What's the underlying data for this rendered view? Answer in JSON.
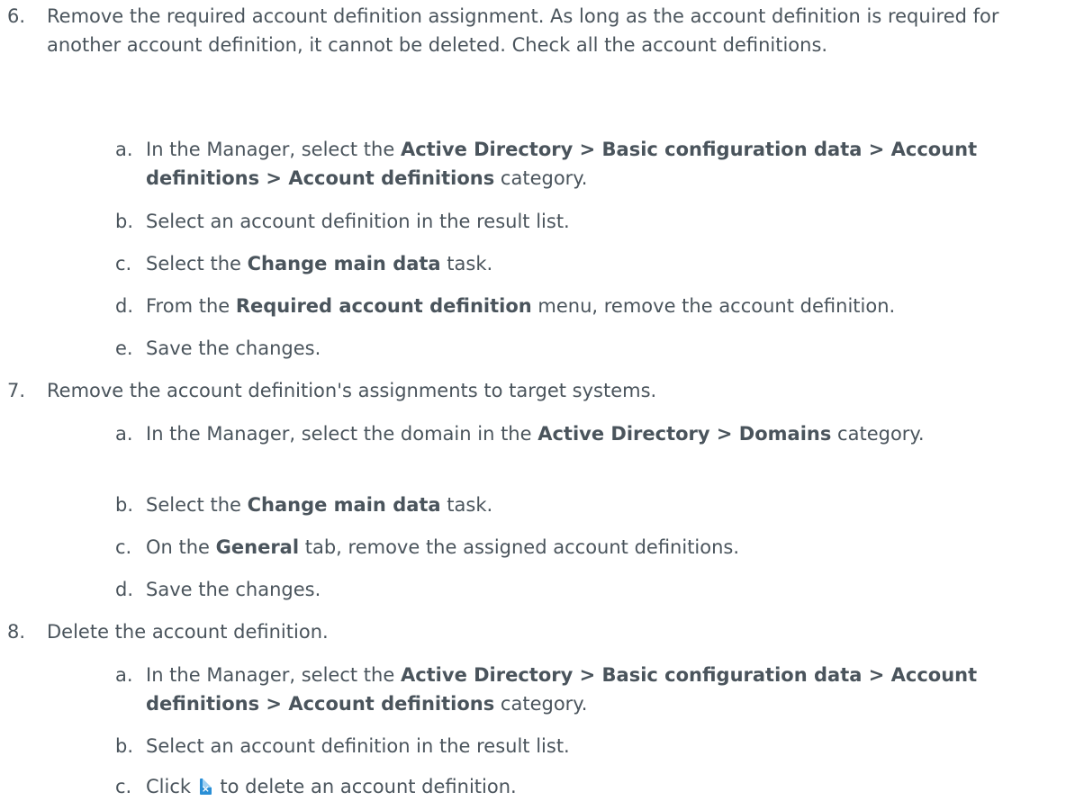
{
  "steps": [
    {
      "num": "6.",
      "text": "Remove the required account definition assignment. As long as the account definition is required for another account definition, it cannot be deleted. Check all the account definitions.",
      "subs": [
        {
          "letter": "a.",
          "t1": "In the Manager, select the ",
          "b1": "Active Directory > Basic configuration data > Account definitions > Account definitions",
          "t2": " category."
        },
        {
          "letter": "b.",
          "t1": "Select an account definition in the result list."
        },
        {
          "letter": "c.",
          "t1": "Select the ",
          "b1": "Change main data",
          "t2": " task."
        },
        {
          "letter": "d.",
          "t1": "From the ",
          "b1": "Required account definition",
          "t2": " menu, remove the account definition."
        },
        {
          "letter": "e.",
          "t1": "Save the changes."
        }
      ]
    },
    {
      "num": "7.",
      "text": "Remove the account definition's assignments to target systems.",
      "subs": [
        {
          "letter": "a.",
          "t1": "In the Manager, select the domain in the ",
          "b1": "Active Directory > Domains",
          "t2": " category."
        },
        {
          "letter": "b.",
          "t1": "Select the ",
          "b1": "Change main data",
          "t2": " task."
        },
        {
          "letter": "c.",
          "t1": "On the ",
          "b1": "General",
          "t2": " tab, remove the assigned account definitions."
        },
        {
          "letter": "d.",
          "t1": "Save the changes."
        }
      ]
    },
    {
      "num": "8.",
      "text": "Delete the account definition.",
      "subs": [
        {
          "letter": "a.",
          "t1": "In the Manager, select the ",
          "b1": "Active Directory > Basic configuration data > Account definitions > Account definitions",
          "t2": " category."
        },
        {
          "letter": "b.",
          "t1": "Select an account definition in the result list."
        },
        {
          "letter": "c.",
          "t1": "Click ",
          "icon": "delete-document-icon",
          "t2": " to delete an account definition."
        }
      ]
    }
  ],
  "colors": {
    "text": "#4a545c",
    "icon": "#2a8fd6"
  }
}
